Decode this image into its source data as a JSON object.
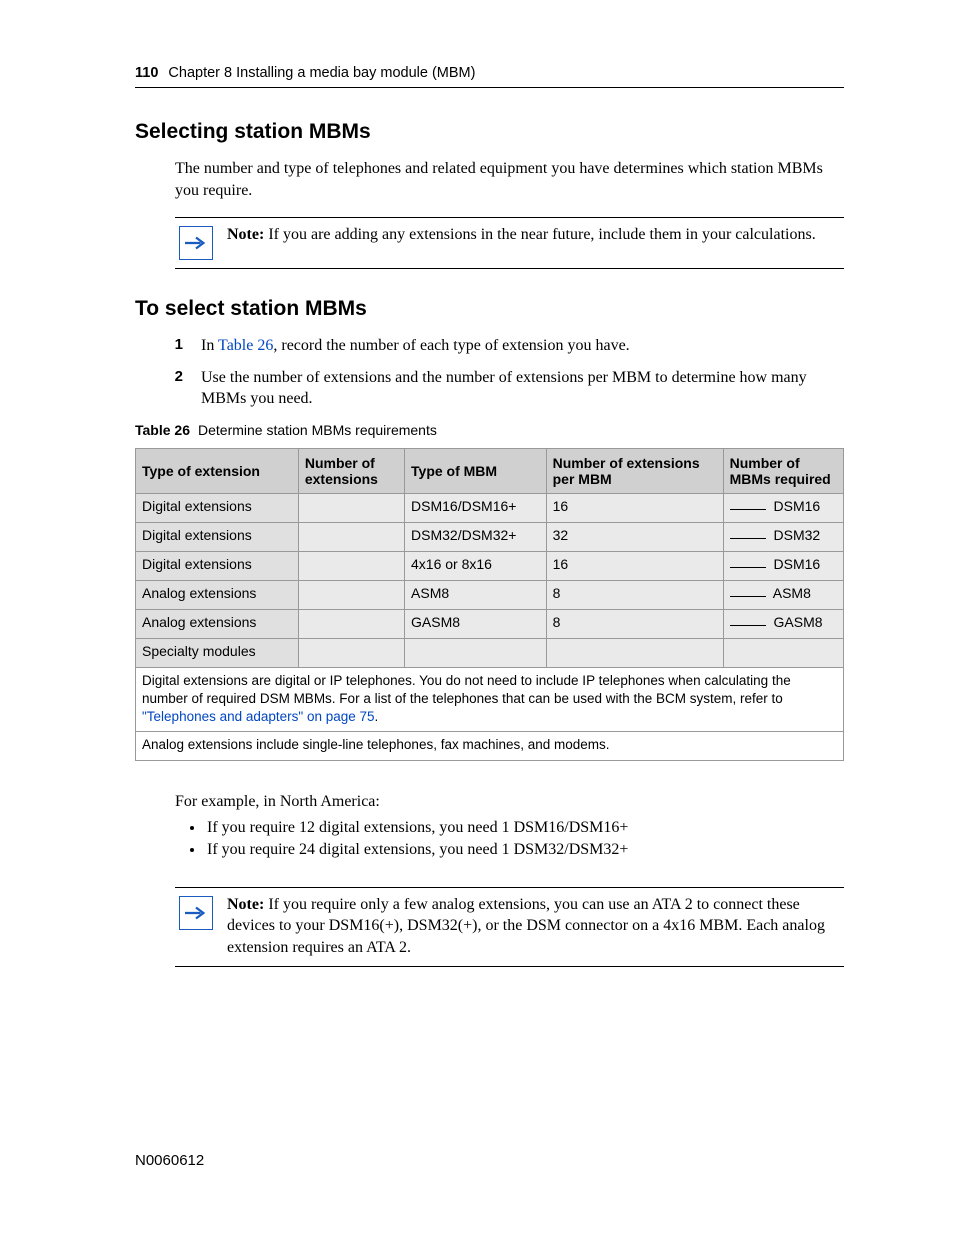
{
  "header": {
    "page_number": "110",
    "chapter_line": "Chapter 8  Installing a media bay module (MBM)"
  },
  "section1": {
    "title": "Selecting station MBMs",
    "body": "The number and type of telephones and related equipment you have determines which station MBMs you require."
  },
  "note1": {
    "label": "Note:",
    "text": " If you are adding any extensions in the near future, include them in your calculations."
  },
  "section2": {
    "title": "To select station MBMs",
    "steps": [
      {
        "pre": "In ",
        "link": "Table 26",
        "post": ", record the number of each type of extension you have."
      },
      {
        "pre": "",
        "link": "",
        "post": "Use the number of extensions and the number of extensions per MBM to determine how many MBMs you need."
      }
    ]
  },
  "table": {
    "caption_label": "Table 26",
    "caption_text": "Determine station MBMs requirements",
    "headers": [
      "Type of extension",
      "Number of extensions",
      "Type of MBM",
      "Number of extensions per MBM",
      "Number of MBMs required"
    ],
    "rows": [
      {
        "type": "Digital extensions",
        "num_ext": "",
        "mbm": "DSM16/DSM16+",
        "per": "16",
        "req": "DSM16"
      },
      {
        "type": "Digital extensions",
        "num_ext": "",
        "mbm": "DSM32/DSM32+",
        "per": "32",
        "req": "DSM32"
      },
      {
        "type": "Digital extensions",
        "num_ext": "",
        "mbm": "4x16 or 8x16",
        "per": "16",
        "req": "DSM16"
      },
      {
        "type": "Analog extensions",
        "num_ext": "",
        "mbm": "ASM8",
        "per": "8",
        "req": "ASM8"
      },
      {
        "type": "Analog extensions",
        "num_ext": "",
        "mbm": "GASM8",
        "per": "8",
        "req": "GASM8"
      },
      {
        "type": "Specialty modules",
        "num_ext": "",
        "mbm": "",
        "per": "",
        "req": ""
      }
    ],
    "footnote1_pre": "Digital extensions are digital or IP telephones. You do not need to include IP telephones when calculating the number of required DSM MBMs. For a list of the telephones that can be used with the BCM system, refer to ",
    "footnote1_link": "\"Telephones and adapters\" on page 75",
    "footnote1_post": ".",
    "footnote2": "Analog extensions include single-line telephones, fax machines, and modems."
  },
  "example": {
    "intro": "For example, in North America:",
    "bullets": [
      "If you require 12 digital extensions, you need 1 DSM16/DSM16+",
      "If you require 24 digital extensions, you need 1 DSM32/DSM32+"
    ]
  },
  "note2": {
    "label": "Note:",
    "text": " If you require only a few analog extensions, you can use an ATA 2 to connect these devices to your DSM16(+), DSM32(+), or the DSM connector on a 4x16 MBM. Each analog extension requires an ATA 2."
  },
  "footer": {
    "doc_number": "N0060612"
  }
}
